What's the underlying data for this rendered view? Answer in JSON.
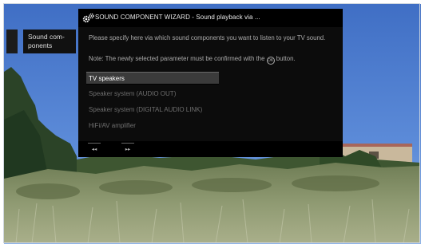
{
  "breadcrumb": {
    "label": "Sound com-\nponents"
  },
  "wizard": {
    "title": "SOUND COMPONENT WIZARD - Sound playback via ...",
    "icon": "gears-icon",
    "description": "Please specify here via which sound components you want to listen to your TV sound.",
    "note_prefix": "Note: The newly selected parameter must be confirmed with the",
    "note_symbol": "OK",
    "note_suffix": "button.",
    "options": [
      "TV speakers",
      "Speaker system (AUDIO OUT)",
      "Speaker system (DIGITAL AUDIO LINK)",
      "HiFi/AV amplifier"
    ],
    "selected_option": "TV speakers",
    "footer": {
      "prev_label": "◂◂",
      "next_label": "▸▸"
    }
  }
}
